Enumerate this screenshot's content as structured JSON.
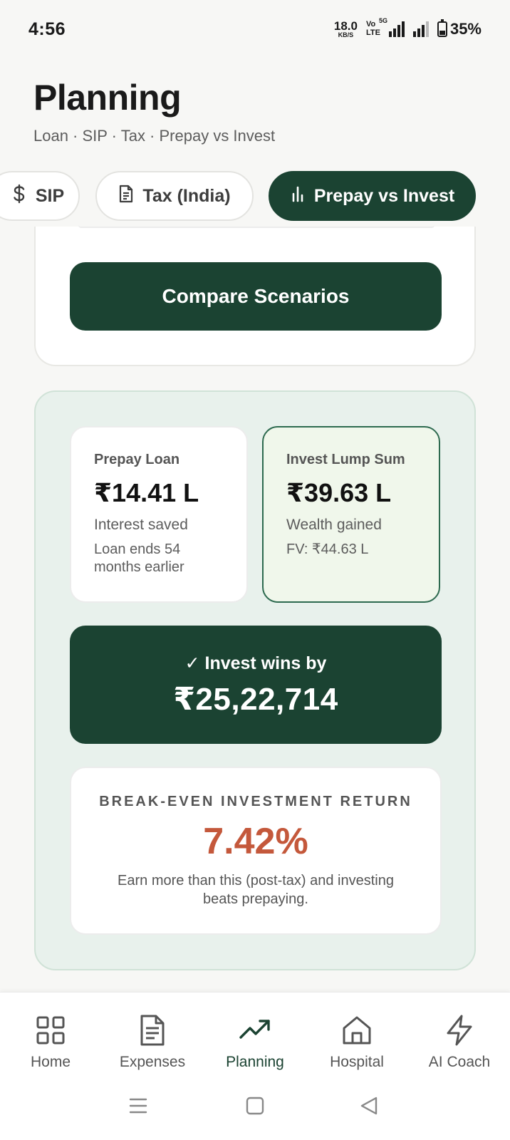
{
  "status_bar": {
    "time": "4:56",
    "net_speed": "18.0",
    "net_speed_unit": "KB/S",
    "volte_top": "Vo",
    "volte_bottom": "LTE",
    "network_tag": "5G",
    "battery": "35%"
  },
  "header": {
    "title": "Planning",
    "subtitle": "Loan · SIP · Tax · Prepay vs Invest"
  },
  "tabs": [
    {
      "label": "SIP",
      "icon": "dollar-icon"
    },
    {
      "label": "Tax (India)",
      "icon": "document-icon"
    },
    {
      "label": "Prepay vs Invest",
      "icon": "bar-chart-icon",
      "active": true
    }
  ],
  "form": {
    "compare_button": "Compare Scenarios"
  },
  "results": {
    "prepay": {
      "label": "Prepay Loan",
      "amount": "₹14.41 L",
      "description": "Interest saved",
      "note": "Loan ends 54 months earlier"
    },
    "invest": {
      "label": "Invest Lump Sum",
      "amount": "₹39.63 L",
      "description": "Wealth gained",
      "note": "FV: ₹44.63 L"
    },
    "winner": {
      "label": "✓ Invest wins by",
      "amount": "₹25,22,714"
    },
    "breakeven": {
      "label": "BREAK-EVEN INVESTMENT RETURN",
      "value": "7.42%",
      "description": "Earn more than this (post-tax) and investing beats prepaying."
    }
  },
  "bottom_nav": [
    {
      "label": "Home",
      "icon": "grid-icon"
    },
    {
      "label": "Expenses",
      "icon": "receipt-icon"
    },
    {
      "label": "Planning",
      "icon": "trending-up-icon",
      "active": true
    },
    {
      "label": "Hospital",
      "icon": "house-icon"
    },
    {
      "label": "AI Coach",
      "icon": "lightning-icon"
    }
  ],
  "colors": {
    "primary": "#1b4332",
    "accent_value": "#c4583b",
    "results_bg": "#e8f1ec",
    "invest_card_bg": "#f0f7eb",
    "page_bg": "#f7f7f5"
  }
}
